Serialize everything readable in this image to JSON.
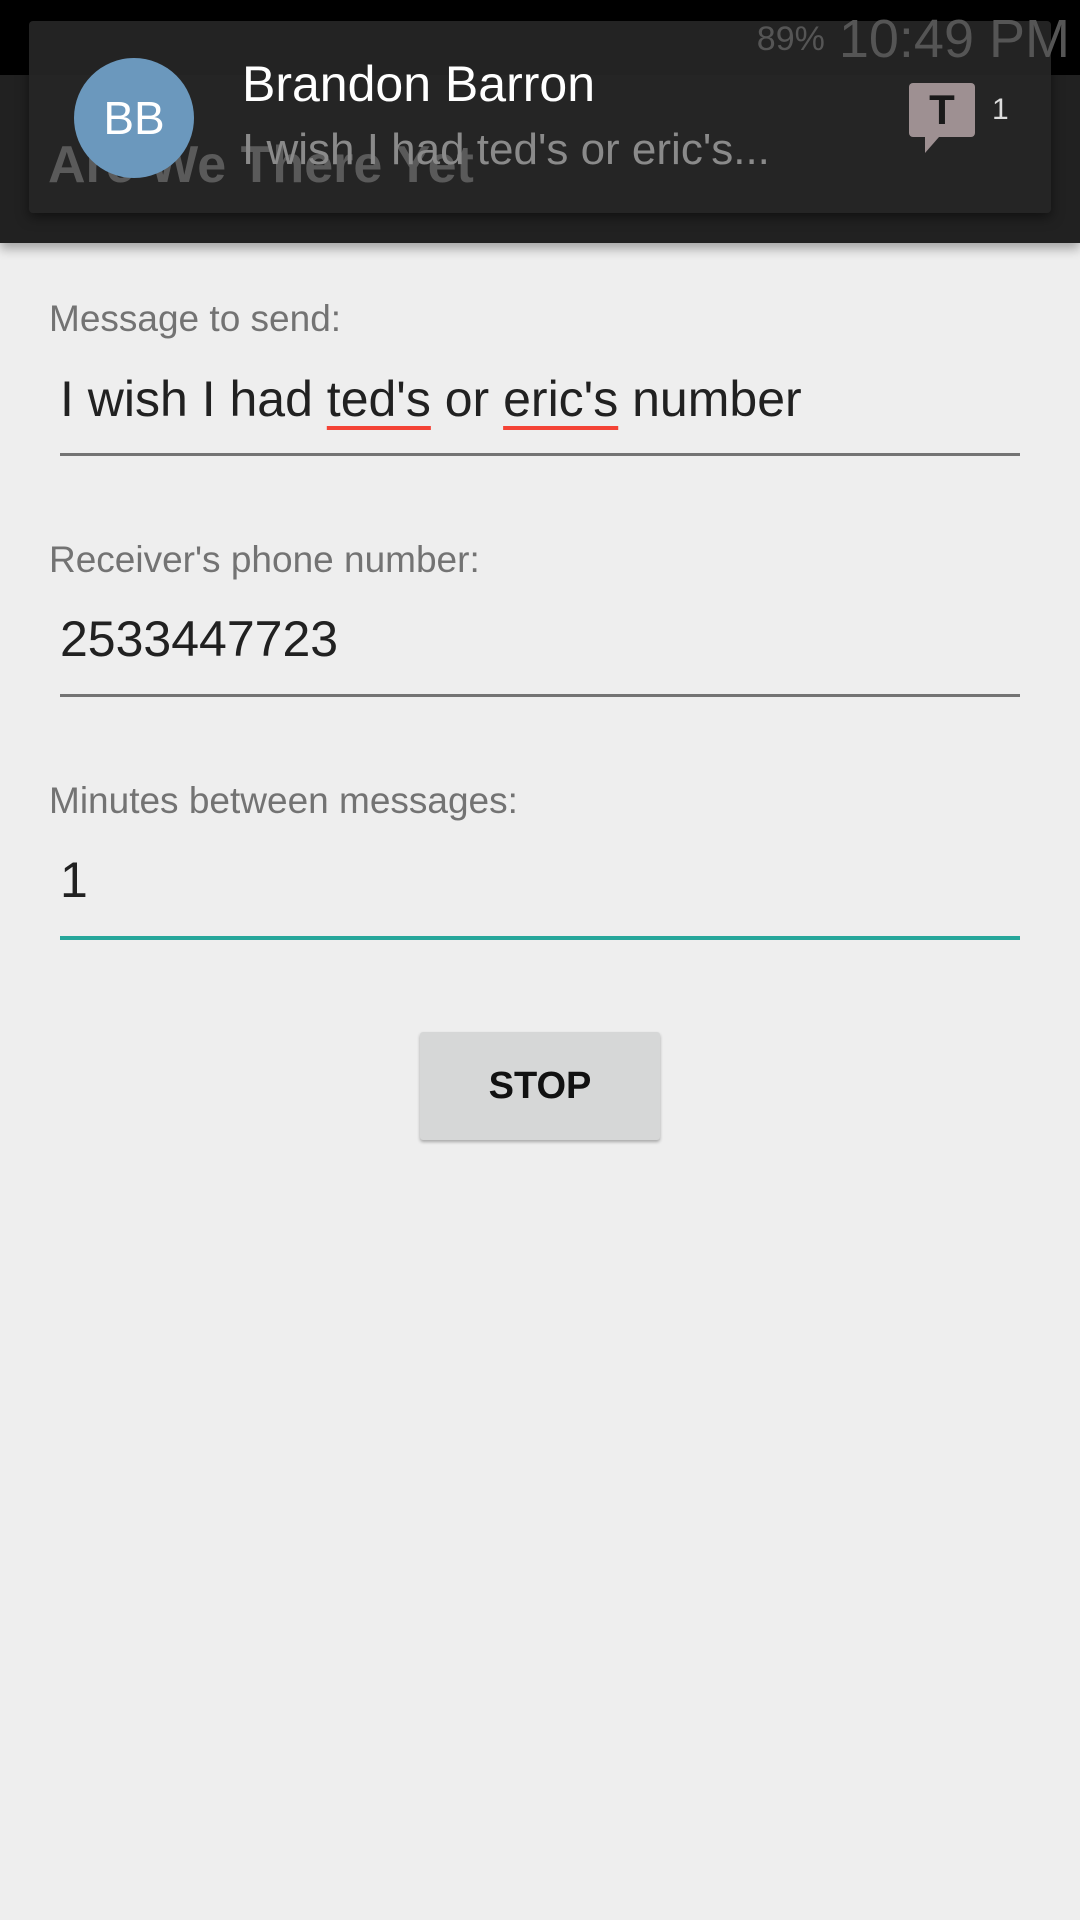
{
  "status_bar": {
    "battery": "89%",
    "time": "10:49 PM"
  },
  "app_bar": {
    "title": "Are We There Yet"
  },
  "notification": {
    "avatar_initials": "BB",
    "sender": "Brandon Barron",
    "preview": "I wish I had ted's or eric's...",
    "app_icon": "T",
    "count": "1"
  },
  "form": {
    "message_label": "Message to send:",
    "message_parts": [
      "I wish I had ",
      "ted's",
      " or ",
      "eric's",
      " number"
    ],
    "phone_label": "Receiver's phone number:",
    "phone_value": "2533447723",
    "minutes_label": "Minutes between messages:",
    "minutes_value": "1"
  },
  "button": {
    "label": "STOP"
  }
}
